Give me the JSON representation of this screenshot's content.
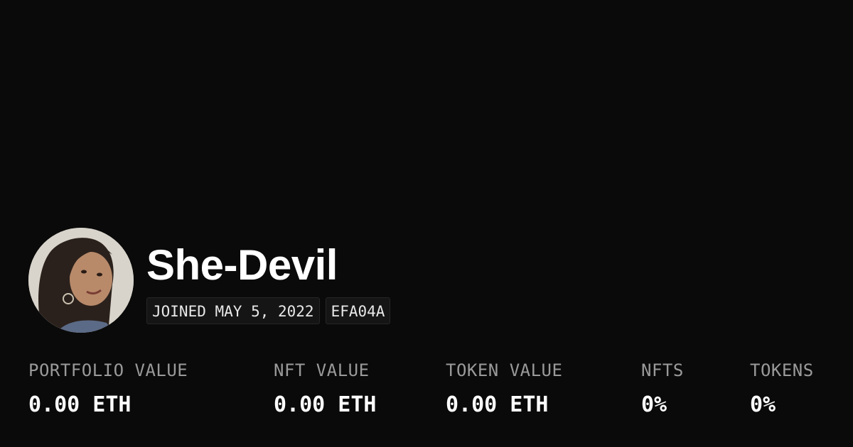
{
  "profile": {
    "name": "She-Devil",
    "joined": "JOINED MAY 5, 2022",
    "hash": "EFA04A"
  },
  "stats": [
    {
      "label": "PORTFOLIO VALUE",
      "value": "0.00 ETH"
    },
    {
      "label": "NFT VALUE",
      "value": "0.00 ETH"
    },
    {
      "label": "TOKEN VALUE",
      "value": "0.00 ETH"
    },
    {
      "label": "NFTS",
      "value": "0%"
    },
    {
      "label": "TOKENS",
      "value": "0%"
    }
  ],
  "colors": {
    "background": "#0a0a0a",
    "text": "#ffffff",
    "label": "#9a9a9a",
    "badge_bg": "#151515"
  }
}
